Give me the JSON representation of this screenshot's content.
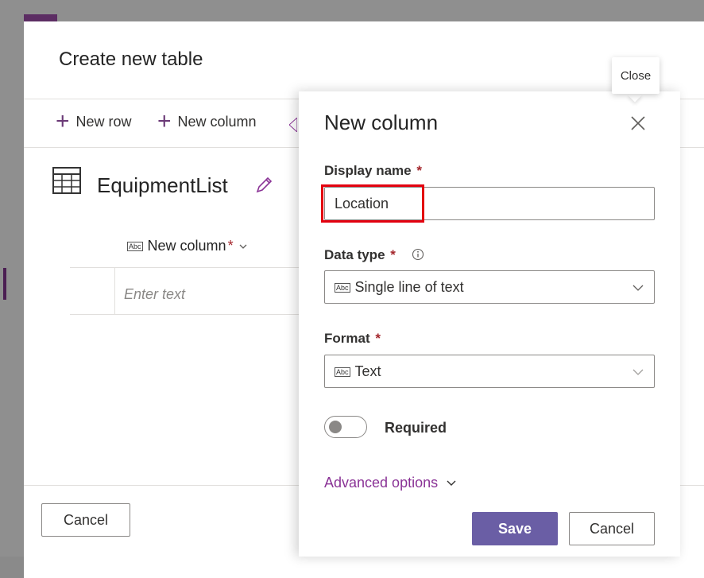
{
  "dialog": {
    "title": "Create new table",
    "toolbar": {
      "new_row": "New row",
      "new_column": "New column"
    },
    "table_name": "EquipmentList",
    "grid": {
      "column_header": "New column",
      "required_mark": "*",
      "cell_placeholder": "Enter text"
    },
    "footer": {
      "cancel": "Cancel"
    }
  },
  "panel": {
    "title": "New column",
    "close_tooltip": "Close",
    "display_name": {
      "label": "Display name",
      "required": "*",
      "value": "Location"
    },
    "data_type": {
      "label": "Data type",
      "required": "*",
      "value": "Single line of text",
      "icon": "abc-icon"
    },
    "format": {
      "label": "Format",
      "required": "*",
      "value": "Text",
      "icon": "abc-icon"
    },
    "required_toggle": {
      "label": "Required",
      "on": false
    },
    "advanced": "Advanced options",
    "save": "Save",
    "cancel": "Cancel"
  },
  "colors": {
    "accent": "#6a5ea5",
    "link": "#8a3396",
    "highlight": "#e3000f"
  }
}
